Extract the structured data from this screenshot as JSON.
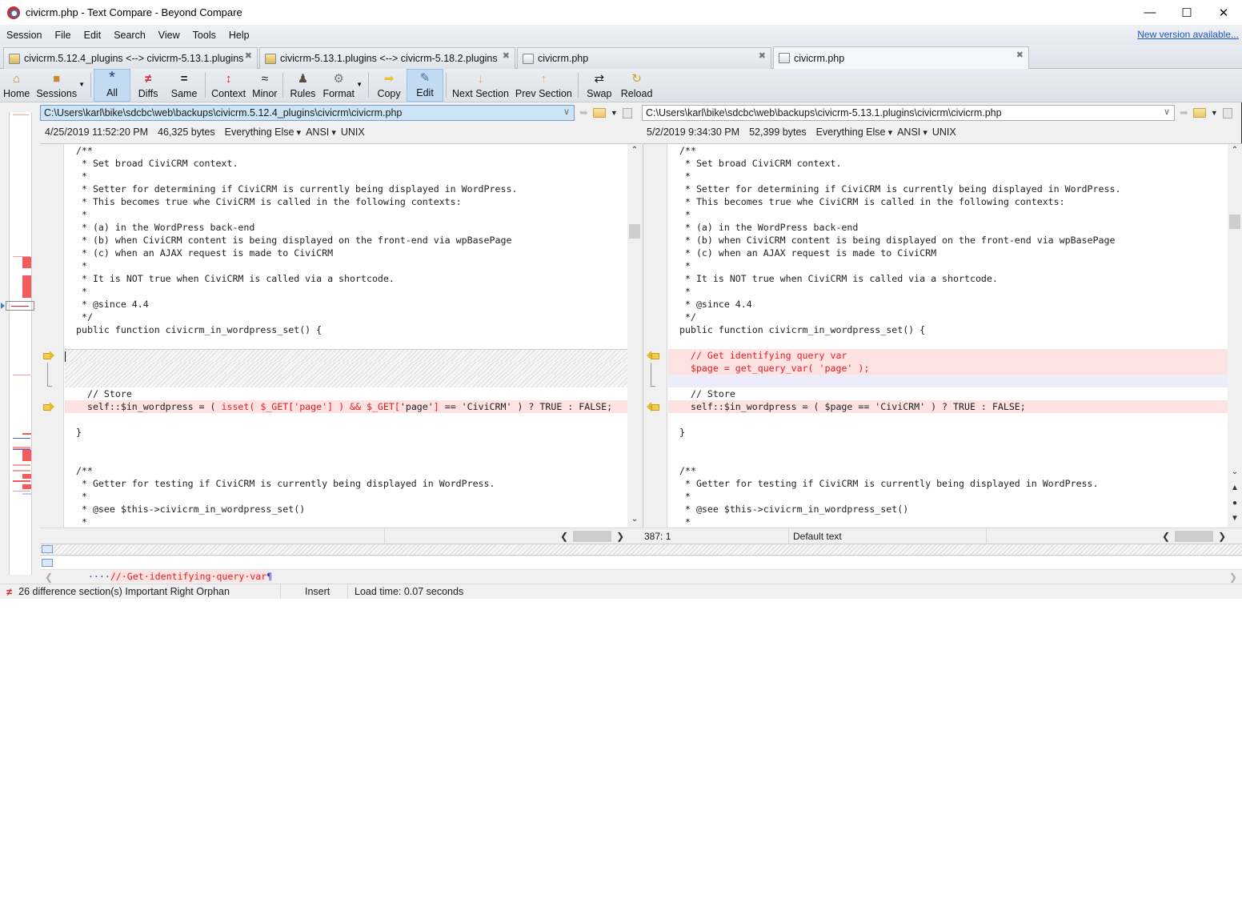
{
  "window": {
    "title": "civicrm.php - Text Compare - Beyond Compare",
    "controls": {
      "minimize": "—",
      "maximize": "☐",
      "close": "✕"
    }
  },
  "menu": {
    "items": [
      "Session",
      "File",
      "Edit",
      "Search",
      "View",
      "Tools",
      "Help"
    ],
    "new_version": "New version available..."
  },
  "tabs": [
    {
      "label": "civicrm.5.12.4_plugins <--> civicrm-5.13.1.plugins",
      "icon": "folder-compare-icon",
      "active": false
    },
    {
      "label": "civicrm-5.13.1.plugins <--> civicrm-5.18.2.plugins",
      "icon": "folder-compare-icon",
      "active": false
    },
    {
      "label": "civicrm.php",
      "icon": "text-compare-icon",
      "active": false
    },
    {
      "label": "civicrm.php",
      "icon": "text-compare-icon",
      "active": true
    }
  ],
  "tab_close_glyph": "✖",
  "toolbar": {
    "buttons": [
      {
        "id": "home",
        "label": "Home",
        "icon": "home-icon",
        "glyph": "⌂"
      },
      {
        "id": "sessions",
        "label": "Sessions",
        "icon": "briefcase-icon",
        "glyph": "■",
        "dropdown": true
      },
      {
        "id": "all",
        "label": "All",
        "icon": "asterisk-icon",
        "glyph": "*",
        "active": true
      },
      {
        "id": "diffs",
        "label": "Diffs",
        "icon": "not-equal-icon",
        "glyph": "≠"
      },
      {
        "id": "same",
        "label": "Same",
        "icon": "equal-icon",
        "glyph": "="
      },
      {
        "id": "context",
        "label": "Context",
        "icon": "context-icon",
        "glyph": "↕"
      },
      {
        "id": "minor",
        "label": "Minor",
        "icon": "approx-icon",
        "glyph": "≈"
      },
      {
        "id": "rules",
        "label": "Rules",
        "icon": "referee-icon",
        "glyph": "♟"
      },
      {
        "id": "format",
        "label": "Format",
        "icon": "format-icon",
        "glyph": "⚙",
        "dropdown": true
      },
      {
        "id": "copy",
        "label": "Copy",
        "icon": "arrow-right-icon",
        "glyph": "➡"
      },
      {
        "id": "edit",
        "label": "Edit",
        "icon": "pencil-icon",
        "glyph": "✎",
        "active": true
      },
      {
        "id": "next_section",
        "label": "Next Section",
        "icon": "arrow-down-icon",
        "glyph": "↓"
      },
      {
        "id": "prev_section",
        "label": "Prev Section",
        "icon": "arrow-up-icon",
        "glyph": "↑"
      },
      {
        "id": "swap",
        "label": "Swap",
        "icon": "swap-icon",
        "glyph": "⇄"
      },
      {
        "id": "reload",
        "label": "Reload",
        "icon": "reload-icon",
        "glyph": "↻"
      }
    ]
  },
  "left": {
    "path": "C:\\Users\\karl\\bike\\sdcbc\\web\\backups\\civicrm.5.12.4_plugins\\civicrm\\civicrm.php",
    "date": "4/25/2019 11:52:20 PM",
    "size": "46,325 bytes",
    "format": "Everything Else",
    "encoding": "ANSI",
    "line_ending": "UNIX",
    "lines": [
      {
        "t": "/**"
      },
      {
        "t": " * Set broad CiviCRM context."
      },
      {
        "t": " *"
      },
      {
        "t": " * Setter for determining if CiviCRM is currently being displayed in WordPress."
      },
      {
        "t": " * This becomes true whe CiviCRM is called in the following contexts:"
      },
      {
        "t": " *"
      },
      {
        "t": " * (a) in the WordPress back-end"
      },
      {
        "t": " * (b) when CiviCRM content is being displayed on the front-end via wpBasePage"
      },
      {
        "t": " * (c) when an AJAX request is made to CiviCRM"
      },
      {
        "t": " *"
      },
      {
        "t": " * It is NOT true when CiviCRM is called via a shortcode."
      },
      {
        "t": " *"
      },
      {
        "t": " * @since 4.4"
      },
      {
        "t": " */"
      },
      {
        "t": "public function civicrm_in_wordpress_set() {"
      },
      {
        "t": ""
      },
      {
        "t": "",
        "kind": "gap"
      },
      {
        "t": "",
        "kind": "gap"
      },
      {
        "t": "",
        "kind": "gap"
      },
      {
        "t": "  // Store"
      },
      {
        "kind": "diff",
        "parts": [
          {
            "t": "  self::$in_wordpress = ( ",
            "hl": false
          },
          {
            "t": "isset( $_GET['page'] ) && $_GET[",
            "hl": true
          },
          {
            "t": "'page'",
            "hl": false
          },
          {
            "t": "]",
            "hl": true
          },
          {
            "t": " == 'CiviCRM' ) ? TRUE : FALSE;",
            "hl": false
          }
        ]
      },
      {
        "t": ""
      },
      {
        "t": "}"
      },
      {
        "t": ""
      },
      {
        "t": ""
      },
      {
        "t": "/**"
      },
      {
        "t": " * Getter for testing if CiviCRM is currently being displayed in WordPress."
      },
      {
        "t": " *"
      },
      {
        "t": " * @see $this->civicrm_in_wordpress_set()"
      },
      {
        "t": " *"
      }
    ]
  },
  "right": {
    "path": "C:\\Users\\karl\\bike\\sdcbc\\web\\backups\\civicrm-5.13.1.plugins\\civicrm\\civicrm.php",
    "date": "5/2/2019 9:34:30 PM",
    "size": "52,399 bytes",
    "format": "Everything Else",
    "encoding": "ANSI",
    "line_ending": "UNIX",
    "lines": [
      {
        "t": "/**"
      },
      {
        "t": " * Set broad CiviCRM context."
      },
      {
        "t": " *"
      },
      {
        "t": " * Setter for determining if CiviCRM is currently being displayed in WordPress."
      },
      {
        "t": " * This becomes true whe CiviCRM is called in the following contexts:"
      },
      {
        "t": " *"
      },
      {
        "t": " * (a) in the WordPress back-end"
      },
      {
        "t": " * (b) when CiviCRM content is being displayed on the front-end via wpBasePage"
      },
      {
        "t": " * (c) when an AJAX request is made to CiviCRM"
      },
      {
        "t": " *"
      },
      {
        "t": " * It is NOT true when CiviCRM is called via a shortcode."
      },
      {
        "t": " *"
      },
      {
        "t": " * @since 4.4"
      },
      {
        "t": " */"
      },
      {
        "t": "public function civicrm_in_wordpress_set() {"
      },
      {
        "t": ""
      },
      {
        "t": "  // Get identifying query var",
        "kind": "diff-all"
      },
      {
        "t": "  $page = get_query_var( 'page' );",
        "kind": "diff-all"
      },
      {
        "t": "",
        "kind": "blank-right"
      },
      {
        "t": "  // Store"
      },
      {
        "t": "  self::$in_wordpress = ( $page == 'CiviCRM' ) ? TRUE : FALSE;",
        "kind": "diff"
      },
      {
        "t": ""
      },
      {
        "t": "}"
      },
      {
        "t": ""
      },
      {
        "t": ""
      },
      {
        "t": "/**"
      },
      {
        "t": " * Getter for testing if CiviCRM is currently being displayed in WordPress."
      },
      {
        "t": " *"
      },
      {
        "t": " * @see $this->civicrm_in_wordpress_set()"
      },
      {
        "t": " *"
      }
    ]
  },
  "pane_status": {
    "cursor_pos": "387: 1",
    "text_format": "Default text"
  },
  "detail_line": {
    "prefix_dots": "····",
    "text": "//·Get·identifying·query·var",
    "eol": "¶"
  },
  "statusbar": {
    "diff_count": "26 difference section(s) Important Right Orphan",
    "mode": "Insert",
    "load_time": "Load time: 0.07 seconds"
  },
  "colors": {
    "diff_text": "#e31e24",
    "diff_bg": "#fde2e2",
    "selection_bg": "#cde4f7",
    "link": "#1a55c4"
  }
}
